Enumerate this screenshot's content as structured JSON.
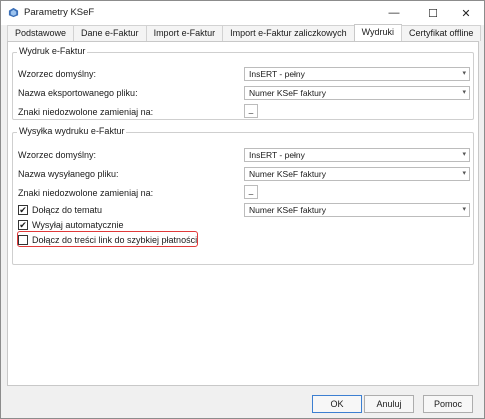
{
  "window": {
    "title": "Parametry KSeF",
    "minimize": "—",
    "maximize": "☐",
    "close": "✕"
  },
  "tabs": [
    {
      "label": "Podstawowe"
    },
    {
      "label": "Dane e-Faktur"
    },
    {
      "label": "Import e-Faktur"
    },
    {
      "label": "Import e-Faktur zaliczkowych"
    },
    {
      "label": "Wydruki",
      "active": true
    },
    {
      "label": "Certyfikat offline"
    }
  ],
  "group1": {
    "title": "Wydruk e-Faktur",
    "template_label": "Wzorzec domyślny:",
    "template_value": "InsERT - pełny",
    "filename_label": "Nazwa eksportowanego pliku:",
    "filename_value": "Numer KSeF faktury",
    "chars_label": "Znaki niedozwolone zamieniaj na:",
    "chars_value": "_"
  },
  "group2": {
    "title": "Wysyłka wydruku e-Faktur",
    "template_label": "Wzorzec domyślny:",
    "template_value": "InsERT - pełny",
    "filename_label": "Nazwa wysyłanego pliku:",
    "filename_value": "Numer KSeF faktury",
    "chars_label": "Znaki niedozwolone zamieniaj na:",
    "chars_value": "_",
    "attach_subject_label": "Dołącz do tematu",
    "attach_subject_checked": true,
    "attach_subject_value": "Numer KSeF faktury",
    "auto_send_label": "Wysyłaj automatycznie",
    "auto_send_checked": true,
    "payment_link_label": "Dołącz do treści link do szybkiej płatności",
    "payment_link_checked": false
  },
  "buttons": {
    "ok": "OK",
    "cancel": "Anuluj",
    "help": "Pomoc"
  },
  "icons": {
    "app": "ksef-app-icon",
    "dropdown": "chevron-down-icon",
    "check": "✔"
  },
  "colors": {
    "highlight": "#e03a3a",
    "default_button_border": "#3c7fd1"
  }
}
